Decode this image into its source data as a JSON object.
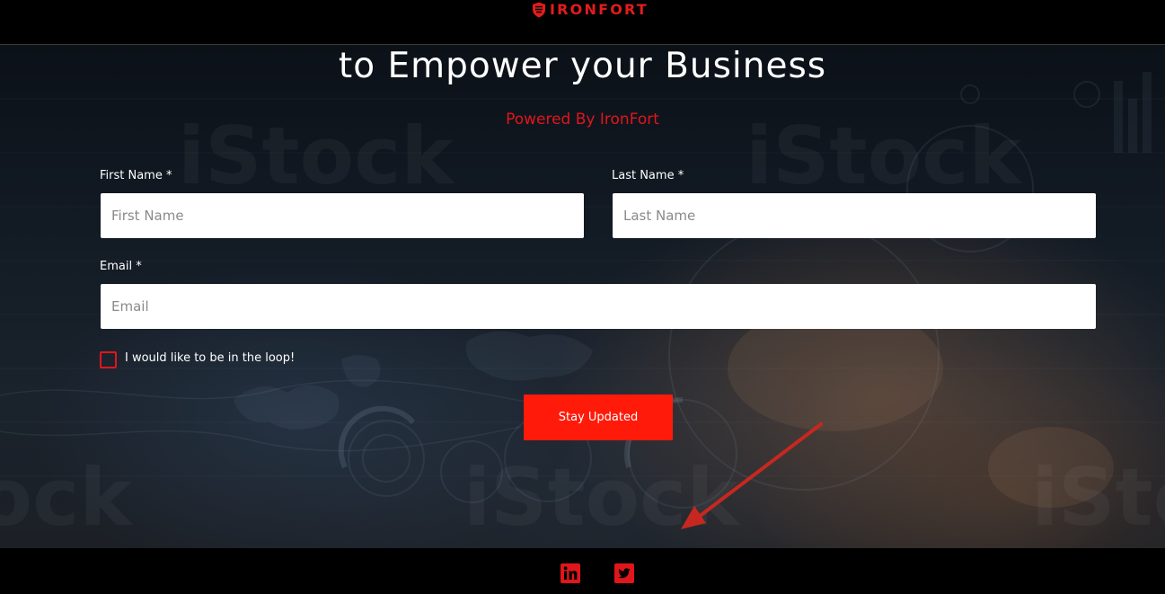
{
  "header": {
    "brand_name": "IRONFORT"
  },
  "hero": {
    "headline": "to Empower your Business",
    "subline": "Powered By IronFort",
    "watermark_text": "iStock"
  },
  "form": {
    "first_name": {
      "label": "First Name *",
      "placeholder": "First Name",
      "value": ""
    },
    "last_name": {
      "label": "Last Name *",
      "placeholder": "Last Name",
      "value": ""
    },
    "email": {
      "label": "Email *",
      "placeholder": "Email",
      "value": ""
    },
    "newsletter_checkbox": {
      "label": "I would like to be in the loop!",
      "checked": false
    },
    "submit_label": "Stay Updated"
  },
  "footer": {
    "social_links": [
      {
        "name": "linkedin-icon"
      },
      {
        "name": "twitter-icon"
      }
    ]
  },
  "colors": {
    "brand_red": "#e0161b",
    "button_red": "#ff1a0a",
    "annotation_arrow": "#c62820",
    "page_black": "#000000"
  }
}
